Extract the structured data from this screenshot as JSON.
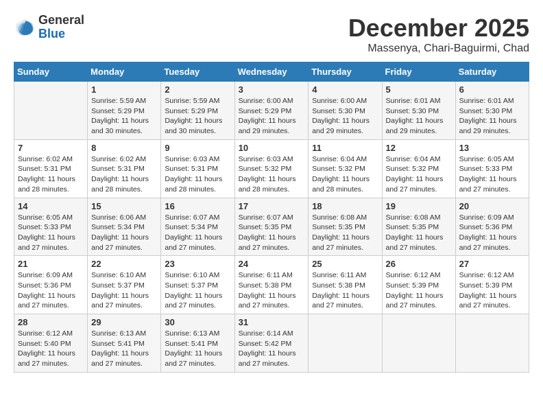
{
  "header": {
    "logo_line1": "General",
    "logo_line2": "Blue",
    "month": "December 2025",
    "location": "Massenya, Chari-Baguirmi, Chad"
  },
  "weekdays": [
    "Sunday",
    "Monday",
    "Tuesday",
    "Wednesday",
    "Thursday",
    "Friday",
    "Saturday"
  ],
  "weeks": [
    [
      {
        "day": "",
        "info": ""
      },
      {
        "day": "1",
        "info": "Sunrise: 5:59 AM\nSunset: 5:29 PM\nDaylight: 11 hours\nand 30 minutes."
      },
      {
        "day": "2",
        "info": "Sunrise: 5:59 AM\nSunset: 5:29 PM\nDaylight: 11 hours\nand 30 minutes."
      },
      {
        "day": "3",
        "info": "Sunrise: 6:00 AM\nSunset: 5:29 PM\nDaylight: 11 hours\nand 29 minutes."
      },
      {
        "day": "4",
        "info": "Sunrise: 6:00 AM\nSunset: 5:30 PM\nDaylight: 11 hours\nand 29 minutes."
      },
      {
        "day": "5",
        "info": "Sunrise: 6:01 AM\nSunset: 5:30 PM\nDaylight: 11 hours\nand 29 minutes."
      },
      {
        "day": "6",
        "info": "Sunrise: 6:01 AM\nSunset: 5:30 PM\nDaylight: 11 hours\nand 29 minutes."
      }
    ],
    [
      {
        "day": "7",
        "info": "Sunrise: 6:02 AM\nSunset: 5:31 PM\nDaylight: 11 hours\nand 28 minutes."
      },
      {
        "day": "8",
        "info": "Sunrise: 6:02 AM\nSunset: 5:31 PM\nDaylight: 11 hours\nand 28 minutes."
      },
      {
        "day": "9",
        "info": "Sunrise: 6:03 AM\nSunset: 5:31 PM\nDaylight: 11 hours\nand 28 minutes."
      },
      {
        "day": "10",
        "info": "Sunrise: 6:03 AM\nSunset: 5:32 PM\nDaylight: 11 hours\nand 28 minutes."
      },
      {
        "day": "11",
        "info": "Sunrise: 6:04 AM\nSunset: 5:32 PM\nDaylight: 11 hours\nand 28 minutes."
      },
      {
        "day": "12",
        "info": "Sunrise: 6:04 AM\nSunset: 5:32 PM\nDaylight: 11 hours\nand 27 minutes."
      },
      {
        "day": "13",
        "info": "Sunrise: 6:05 AM\nSunset: 5:33 PM\nDaylight: 11 hours\nand 27 minutes."
      }
    ],
    [
      {
        "day": "14",
        "info": "Sunrise: 6:05 AM\nSunset: 5:33 PM\nDaylight: 11 hours\nand 27 minutes."
      },
      {
        "day": "15",
        "info": "Sunrise: 6:06 AM\nSunset: 5:34 PM\nDaylight: 11 hours\nand 27 minutes."
      },
      {
        "day": "16",
        "info": "Sunrise: 6:07 AM\nSunset: 5:34 PM\nDaylight: 11 hours\nand 27 minutes."
      },
      {
        "day": "17",
        "info": "Sunrise: 6:07 AM\nSunset: 5:35 PM\nDaylight: 11 hours\nand 27 minutes."
      },
      {
        "day": "18",
        "info": "Sunrise: 6:08 AM\nSunset: 5:35 PM\nDaylight: 11 hours\nand 27 minutes."
      },
      {
        "day": "19",
        "info": "Sunrise: 6:08 AM\nSunset: 5:35 PM\nDaylight: 11 hours\nand 27 minutes."
      },
      {
        "day": "20",
        "info": "Sunrise: 6:09 AM\nSunset: 5:36 PM\nDaylight: 11 hours\nand 27 minutes."
      }
    ],
    [
      {
        "day": "21",
        "info": "Sunrise: 6:09 AM\nSunset: 5:36 PM\nDaylight: 11 hours\nand 27 minutes."
      },
      {
        "day": "22",
        "info": "Sunrise: 6:10 AM\nSunset: 5:37 PM\nDaylight: 11 hours\nand 27 minutes."
      },
      {
        "day": "23",
        "info": "Sunrise: 6:10 AM\nSunset: 5:37 PM\nDaylight: 11 hours\nand 27 minutes."
      },
      {
        "day": "24",
        "info": "Sunrise: 6:11 AM\nSunset: 5:38 PM\nDaylight: 11 hours\nand 27 minutes."
      },
      {
        "day": "25",
        "info": "Sunrise: 6:11 AM\nSunset: 5:38 PM\nDaylight: 11 hours\nand 27 minutes."
      },
      {
        "day": "26",
        "info": "Sunrise: 6:12 AM\nSunset: 5:39 PM\nDaylight: 11 hours\nand 27 minutes."
      },
      {
        "day": "27",
        "info": "Sunrise: 6:12 AM\nSunset: 5:39 PM\nDaylight: 11 hours\nand 27 minutes."
      }
    ],
    [
      {
        "day": "28",
        "info": "Sunrise: 6:12 AM\nSunset: 5:40 PM\nDaylight: 11 hours\nand 27 minutes."
      },
      {
        "day": "29",
        "info": "Sunrise: 6:13 AM\nSunset: 5:41 PM\nDaylight: 11 hours\nand 27 minutes."
      },
      {
        "day": "30",
        "info": "Sunrise: 6:13 AM\nSunset: 5:41 PM\nDaylight: 11 hours\nand 27 minutes."
      },
      {
        "day": "31",
        "info": "Sunrise: 6:14 AM\nSunset: 5:42 PM\nDaylight: 11 hours\nand 27 minutes."
      },
      {
        "day": "",
        "info": ""
      },
      {
        "day": "",
        "info": ""
      },
      {
        "day": "",
        "info": ""
      }
    ]
  ]
}
